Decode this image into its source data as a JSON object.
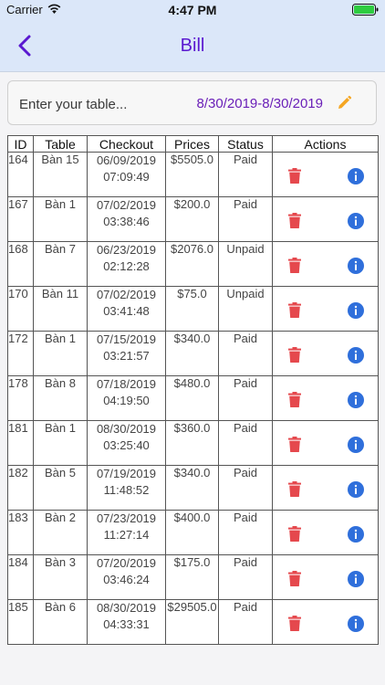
{
  "status_bar": {
    "carrier": "Carrier",
    "time": "4:47 PM"
  },
  "nav": {
    "title": "Bill"
  },
  "filter": {
    "placeholder": "Enter your table...",
    "date_range": "8/30/2019-8/30/2019"
  },
  "colors": {
    "accent": "#5a18d0",
    "trash": "#e5484d",
    "info": "#2f6fdb",
    "edit": "#f5a623"
  },
  "table": {
    "headers": {
      "id": "ID",
      "table": "Table",
      "checkout": "Checkout",
      "prices": "Prices",
      "status": "Status",
      "actions": "Actions"
    },
    "rows": [
      {
        "id": "164",
        "table": "Bàn 15",
        "date": "06/09/2019",
        "time": "07:09:49",
        "price": "$5505.0",
        "status": "Paid"
      },
      {
        "id": "167",
        "table": "Bàn 1",
        "date": "07/02/2019",
        "time": "03:38:46",
        "price": "$200.0",
        "status": "Paid"
      },
      {
        "id": "168",
        "table": "Bàn 7",
        "date": "06/23/2019",
        "time": "02:12:28",
        "price": "$2076.0",
        "status": "Unpaid"
      },
      {
        "id": "170",
        "table": "Bàn 11",
        "date": "07/02/2019",
        "time": "03:41:48",
        "price": "$75.0",
        "status": "Unpaid"
      },
      {
        "id": "172",
        "table": "Bàn 1",
        "date": "07/15/2019",
        "time": "03:21:57",
        "price": "$340.0",
        "status": "Paid"
      },
      {
        "id": "178",
        "table": "Bàn 8",
        "date": "07/18/2019",
        "time": "04:19:50",
        "price": "$480.0",
        "status": "Paid"
      },
      {
        "id": "181",
        "table": "Bàn 1",
        "date": "08/30/2019",
        "time": "03:25:40",
        "price": "$360.0",
        "status": "Paid"
      },
      {
        "id": "182",
        "table": "Bàn 5",
        "date": "07/19/2019",
        "time": "11:48:52",
        "price": "$340.0",
        "status": "Paid"
      },
      {
        "id": "183",
        "table": "Bàn 2",
        "date": "07/23/2019",
        "time": "11:27:14",
        "price": "$400.0",
        "status": "Paid"
      },
      {
        "id": "184",
        "table": "Bàn 3",
        "date": "07/20/2019",
        "time": "03:46:24",
        "price": "$175.0",
        "status": "Paid"
      },
      {
        "id": "185",
        "table": "Bàn 6",
        "date": "08/30/2019",
        "time": "04:33:31",
        "price": "$29505.0",
        "status": "Paid"
      }
    ]
  }
}
